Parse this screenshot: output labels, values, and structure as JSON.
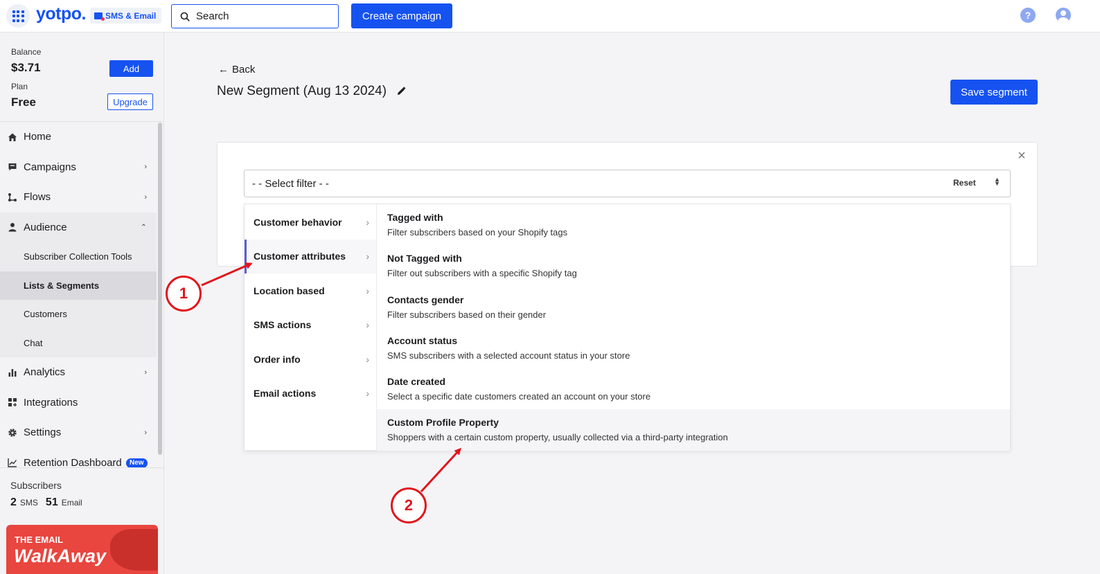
{
  "topbar": {
    "logo": "yotpo.",
    "product": "SMS & Email",
    "search_placeholder": "Search",
    "create_campaign": "Create campaign",
    "help": "?"
  },
  "sidebar": {
    "balance_label": "Balance",
    "balance_value": "$3.71",
    "add": "Add",
    "plan_label": "Plan",
    "plan_value": "Free",
    "upgrade": "Upgrade",
    "nav": {
      "home": "Home",
      "campaigns": "Campaigns",
      "flows": "Flows",
      "audience": "Audience",
      "sub_collection": "Subscriber Collection Tools",
      "lists_segments": "Lists & Segments",
      "customers": "Customers",
      "chat": "Chat",
      "analytics": "Analytics",
      "integrations": "Integrations",
      "settings": "Settings",
      "retention": "Retention Dashboard",
      "new_badge": "New"
    },
    "subscribers_label": "Subscribers",
    "sms_count": "2",
    "sms_label": "SMS",
    "email_count": "51",
    "email_label": "Email",
    "promo_line1": "THE EMAIL",
    "promo_line2": "WalkAway"
  },
  "main": {
    "back": "Back",
    "title": "New Segment (Aug 13 2024)",
    "save": "Save segment",
    "select_placeholder": "- - Select filter - -",
    "reset": "Reset",
    "categories": [
      "Customer behavior",
      "Customer attributes",
      "Location based",
      "SMS actions",
      "Order info",
      "Email actions"
    ],
    "options": [
      {
        "title": "Tagged with",
        "desc": "Filter subscribers based on your Shopify tags"
      },
      {
        "title": "Not Tagged with",
        "desc": "Filter out subscribers with a specific Shopify tag"
      },
      {
        "title": "Contacts gender",
        "desc": "Filter subscribers based on their gender"
      },
      {
        "title": "Account status",
        "desc": "SMS subscribers with a selected account status in your store"
      },
      {
        "title": "Date created",
        "desc": "Select a specific date customers created an account on your store"
      },
      {
        "title": "Custom Profile Property",
        "desc": "Shoppers with a certain custom property, usually collected via a third-party integration"
      }
    ]
  },
  "annotations": {
    "step1": "1",
    "step2": "2",
    "color": "#e0161b"
  },
  "colors": {
    "brand": "#1652f0",
    "active_indicator": "#5b5bd6"
  }
}
